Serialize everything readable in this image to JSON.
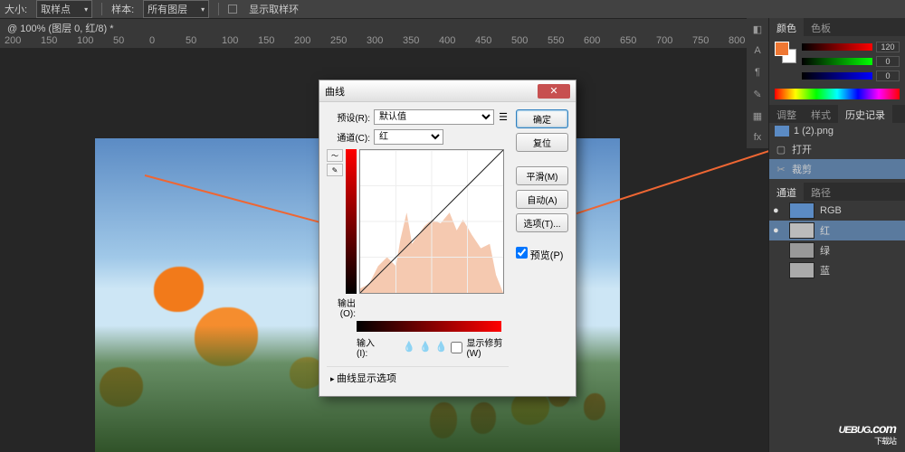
{
  "topbar": {
    "size_lbl": "大小:",
    "size_val": "取样点",
    "style_lbl": "样本:",
    "style_val": "所有图层",
    "show_ring": "显示取样环"
  },
  "doctab": "@ 100% (图层 0, 红/8) *",
  "ruler": [
    "200",
    "150",
    "100",
    "50",
    "0",
    "50",
    "100",
    "150",
    "200",
    "250",
    "300",
    "350",
    "400",
    "450",
    "500",
    "550",
    "600",
    "650",
    "700",
    "750",
    "800"
  ],
  "color": {
    "tab1": "颜色",
    "tab2": "色板",
    "r": "120",
    "g": "0",
    "b": "0"
  },
  "history": {
    "tab1": "调整",
    "tab2": "样式",
    "tab3": "历史记录",
    "file": "1 (2).png",
    "open": "打开",
    "crop": "裁剪"
  },
  "channels": {
    "tab1": "通道",
    "tab2": "路径",
    "rgb": "RGB",
    "r": "红",
    "g": "绿",
    "b": "蓝"
  },
  "dialog": {
    "title": "曲线",
    "preset_lbl": "预设(R):",
    "preset_val": "默认值",
    "channel_lbl": "通道(C):",
    "channel_val": "红",
    "output_lbl": "输出(O):",
    "input_lbl": "输入(I):",
    "show_clip": "显示修剪(W)",
    "curve_opts": "曲线显示选项",
    "ok": "确定",
    "cancel": "复位",
    "smooth": "平滑(M)",
    "auto": "自动(A)",
    "options": "选项(T)...",
    "preview": "预览(P)"
  },
  "watermark": {
    "brand": "UEBUG",
    "tld": ".com",
    "sub": "下载站"
  }
}
